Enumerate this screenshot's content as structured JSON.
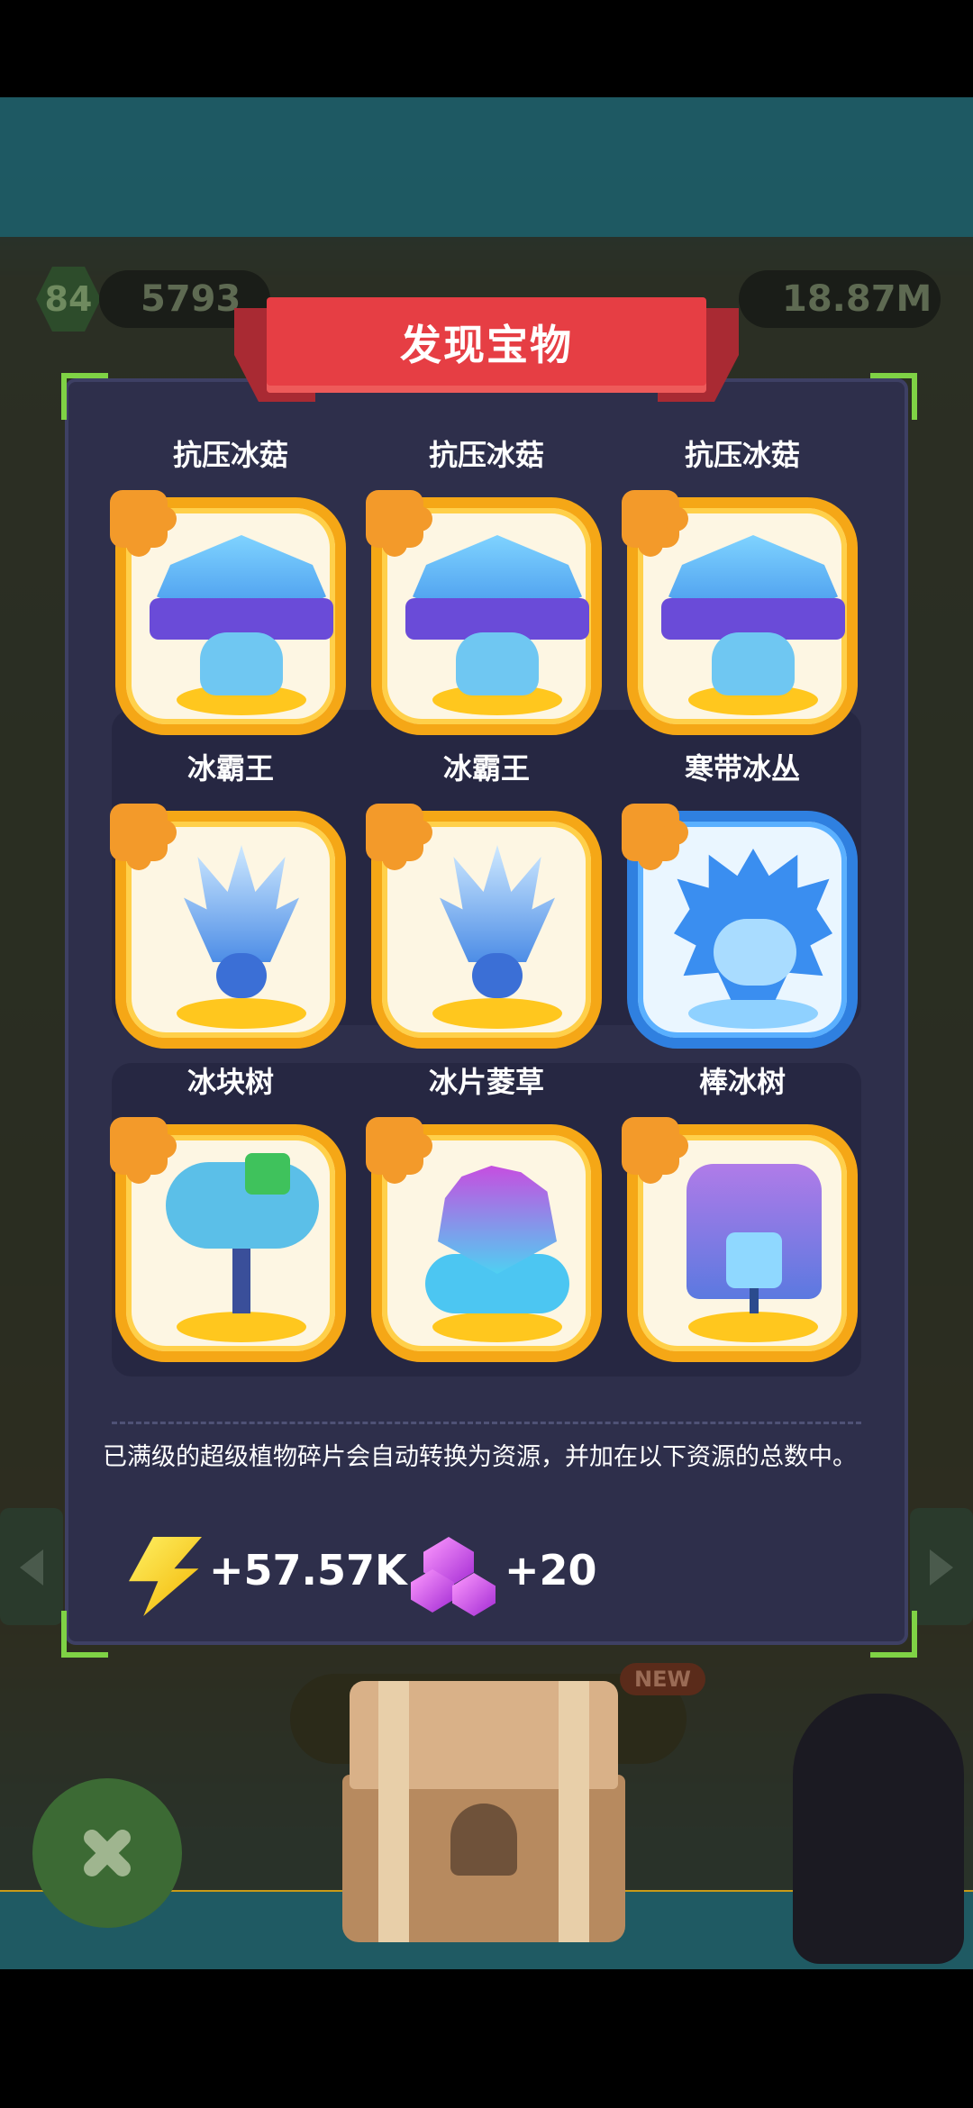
{
  "background": {
    "level": "84",
    "coins": "5793",
    "energy": "18.87M",
    "new_badge": "NEW"
  },
  "dialog": {
    "title": "发现宝物",
    "cards": [
      {
        "name": "抗压冰菇",
        "art": "ice-mushroom",
        "frame": "gold"
      },
      {
        "name": "抗压冰菇",
        "art": "ice-mushroom",
        "frame": "gold"
      },
      {
        "name": "抗压冰菇",
        "art": "ice-mushroom",
        "frame": "gold"
      },
      {
        "name": "冰霸王",
        "art": "ice-spike-king",
        "frame": "gold"
      },
      {
        "name": "冰霸王",
        "art": "ice-spike-king",
        "frame": "gold"
      },
      {
        "name": "寒带冰丛",
        "art": "ice-urchin",
        "frame": "blue"
      },
      {
        "name": "冰块树",
        "art": "ice-cube-tree",
        "frame": "gold"
      },
      {
        "name": "冰片菱草",
        "art": "ice-crystal-grass",
        "frame": "gold"
      },
      {
        "name": "棒冰树",
        "art": "popsicle-tree",
        "frame": "gold"
      }
    ],
    "info": "已满级的超级植物碎片会自动转换为资源，并加在以下资源的总数中。",
    "rewards": [
      {
        "icon": "lightning-bolt-icon",
        "value": "+57.57K"
      },
      {
        "icon": "purple-gem-icon",
        "value": "+20"
      }
    ]
  },
  "colors": {
    "dialog_bg": "#2e2f4b",
    "ribbon": "#e63e44",
    "gold_frame": "#f5a716",
    "blue_frame": "#2f80e0",
    "corner_accent": "#7fd245"
  }
}
